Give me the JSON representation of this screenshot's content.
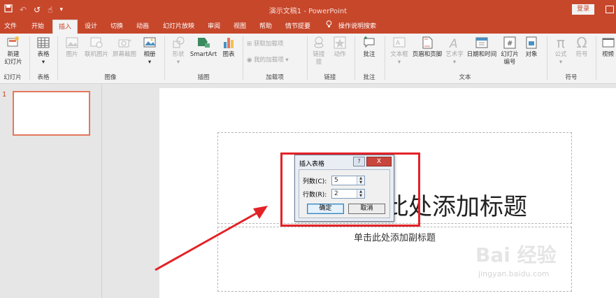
{
  "window": {
    "title": "演示文稿1 - PowerPoint",
    "login_label": "登录"
  },
  "quick_access": [
    "save-icon",
    "undo-icon",
    "redo-icon",
    "touch-mode-icon",
    "customize-icon"
  ],
  "tabs": [
    "文件",
    "开始",
    "插入",
    "设计",
    "切换",
    "动画",
    "幻灯片放映",
    "审阅",
    "视图",
    "帮助",
    "情节提要",
    "操作说明搜索"
  ],
  "active_tab": "插入",
  "ribbon": {
    "groups": {
      "slides": "幻灯片",
      "tables": "表格",
      "images": "图像",
      "illustrations": "插图",
      "addins": "加载项",
      "links": "链接",
      "comments": "批注",
      "text": "文本",
      "symbols": "符号"
    },
    "buttons": {
      "new_slide": "新建",
      "new_slide_2": "幻灯片",
      "table": "表格",
      "picture": "图片",
      "online_picture": "联机图片",
      "screenshot": "屏幕截图",
      "album": "相册",
      "shapes": "形状",
      "smartart": "SmartArt",
      "chart": "图表",
      "get_addins": "获取加载项",
      "my_addins": "我的加载项",
      "link": "链接",
      "link_2": "接",
      "action": "动作",
      "comment": "批注",
      "textbox": "文本框",
      "header_footer": "页眉和页脚",
      "wordart": "艺术字",
      "datetime": "日期和时间",
      "slide_number": "幻灯片",
      "slide_number_2": "编号",
      "object": "对象",
      "equation": "公式",
      "symbol": "符号",
      "video": "视频"
    }
  },
  "thumbnails": {
    "slide_number": "1"
  },
  "slide": {
    "title_placeholder": "单击此处添加标题",
    "subtitle_placeholder": "单击此处添加副标题"
  },
  "dialog": {
    "title": "插入表格",
    "help": "?",
    "close": "X",
    "columns_label": "列数(C):",
    "columns_value": "5",
    "rows_label": "行数(R):",
    "rows_value": "2",
    "ok": "确定",
    "cancel": "取消"
  },
  "watermark": {
    "brand": "Bai 经验",
    "url": "jingyan.baidu.com"
  },
  "colors": {
    "accent": "#c7472b",
    "annotation": "#e32226"
  }
}
